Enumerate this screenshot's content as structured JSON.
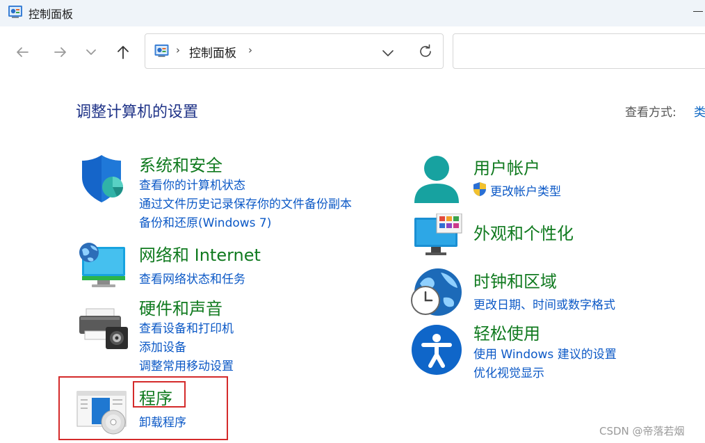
{
  "window": {
    "title": "控制面板"
  },
  "address": {
    "separator": "›",
    "crumb": "控制面板",
    "crumb_separator": "›"
  },
  "search": {
    "placeholder": ""
  },
  "page": {
    "title": "调整计算机的设置",
    "view_by_label": "查看方式:",
    "view_by_value": "类"
  },
  "categories": {
    "system": {
      "title": "系统和安全",
      "links": [
        "查看你的计算机状态",
        "通过文件历史记录保存你的文件备份副本",
        "备份和还原(Windows 7)"
      ]
    },
    "network": {
      "title": "网络和 Internet",
      "links": [
        "查看网络状态和任务"
      ]
    },
    "hardware": {
      "title": "硬件和声音",
      "links": [
        "查看设备和打印机",
        "添加设备",
        "调整常用移动设置"
      ]
    },
    "programs": {
      "title": "程序",
      "links": [
        "卸载程序"
      ]
    },
    "users": {
      "title": "用户帐户",
      "links": [
        "更改帐户类型"
      ]
    },
    "appearance": {
      "title": "外观和个性化",
      "links": []
    },
    "clock": {
      "title": "时钟和区域",
      "links": [
        "更改日期、时间或数字格式"
      ]
    },
    "ease": {
      "title": "轻松使用",
      "links": [
        "使用 Windows 建议的设置",
        "优化视觉显示"
      ]
    }
  },
  "watermark": "CSDN @帝落若烟",
  "colors": {
    "title_text": "#1e3287",
    "category_title": "#107a1f",
    "link": "#0b58c6",
    "highlight": "#d42a2a",
    "titlebar_bg": "#eff4f9"
  },
  "icons": {
    "app": "control-panel-icon",
    "back": "arrow-left-icon",
    "forward": "arrow-right-icon",
    "recent": "chevron-down-icon",
    "up": "arrow-up-icon",
    "dropdown": "chevron-down-icon",
    "refresh": "refresh-icon",
    "system": "shield-icon",
    "network": "globe-monitor-icon",
    "hardware": "printer-speaker-icon",
    "programs": "programs-disc-icon",
    "users": "user-icon",
    "uac": "uac-shield-icon",
    "appearance": "monitor-palette-icon",
    "clock": "globe-clock-icon",
    "ease": "accessibility-icon"
  }
}
